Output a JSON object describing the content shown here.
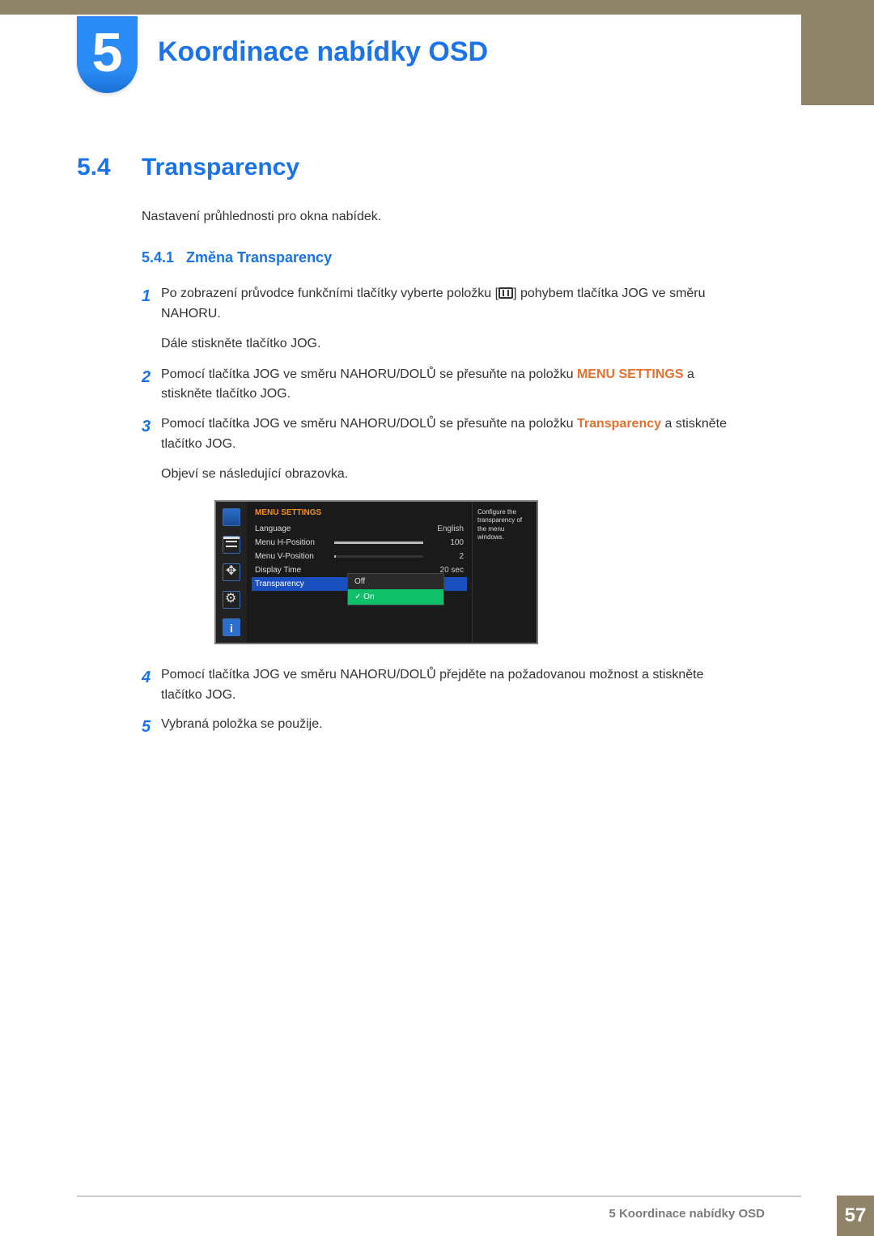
{
  "chapter": {
    "number": "5",
    "title": "Koordinace nabídky OSD"
  },
  "section": {
    "number": "5.4",
    "title": "Transparency",
    "intro": "Nastavení průhlednosti pro okna nabídek."
  },
  "subsection": {
    "number": "5.4.1",
    "title": "Změna Transparency"
  },
  "steps": {
    "s1": {
      "num": "1",
      "part_a": "Po zobrazení průvodce funkčními tlačítky vyberte položku [",
      "part_b": "] pohybem tlačítka JOG ve směru NAHORU.",
      "sub": "Dále stiskněte tlačítko JOG."
    },
    "s2": {
      "num": "2",
      "part_a": "Pomocí tlačítka JOG ve směru NAHORU/DOLŮ se přesuňte na položku ",
      "bold": "MENU SETTINGS",
      "part_b": " a stiskněte tlačítko JOG."
    },
    "s3": {
      "num": "3",
      "part_a": "Pomocí tlačítka JOG ve směru NAHORU/DOLŮ se přesuňte na položku ",
      "bold": "Transparency",
      "part_b": " a stiskněte tlačítko JOG.",
      "sub": "Objeví se následující obrazovka."
    },
    "s4": {
      "num": "4",
      "text": "Pomocí tlačítka JOG ve směru NAHORU/DOLŮ přejděte na požadovanou možnost a stiskněte tlačítko JOG."
    },
    "s5": {
      "num": "5",
      "text": "Vybraná položka se použije."
    }
  },
  "osd": {
    "header": "MENU SETTINGS",
    "rows": {
      "language": {
        "label": "Language",
        "value": "English"
      },
      "hpos": {
        "label": "Menu H-Position",
        "value": "100",
        "fill": 100
      },
      "vpos": {
        "label": "Menu V-Position",
        "value": "2",
        "fill": 2
      },
      "dtime": {
        "label": "Display Time",
        "value": "20 sec"
      },
      "transp": {
        "label": "Transparency"
      }
    },
    "dropdown": {
      "off": "Off",
      "on": "On"
    },
    "help": "Configure the transparency of the menu windows.",
    "sidebar_info": "i"
  },
  "footer": {
    "text": "5 Koordinace nabídky OSD",
    "page": "57"
  }
}
